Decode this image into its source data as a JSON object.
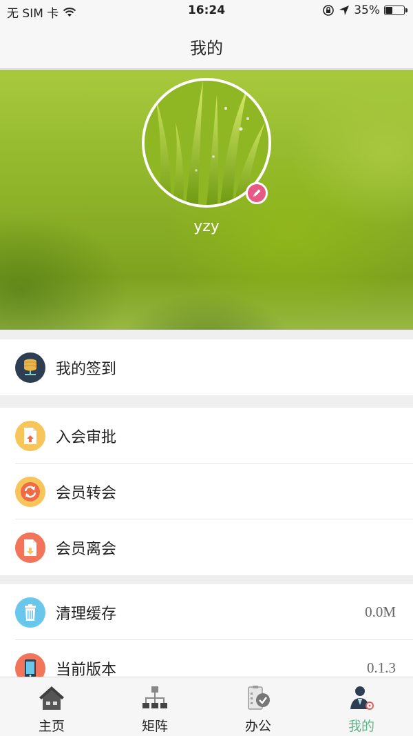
{
  "status_bar": {
    "carrier": "无 SIM 卡",
    "time": "16:24",
    "battery": "35%",
    "battery_level": 0.35
  },
  "nav": {
    "title": "我的"
  },
  "profile": {
    "username": "yzy"
  },
  "sections": {
    "checkin": {
      "label": "我的签到"
    },
    "join_approval": {
      "label": "入会审批"
    },
    "member_transfer": {
      "label": "会员转会"
    },
    "member_leave": {
      "label": "会员离会"
    },
    "clear_cache": {
      "label": "清理缓存",
      "value": "0.0M"
    },
    "version": {
      "label": "当前版本",
      "value": "0.1.3"
    }
  },
  "tabs": [
    {
      "label": "主页",
      "icon": "home-icon"
    },
    {
      "label": "矩阵",
      "icon": "matrix-icon"
    },
    {
      "label": "办公",
      "icon": "office-icon"
    },
    {
      "label": "我的",
      "icon": "profile-icon",
      "active": true
    }
  ],
  "colors": {
    "active_tab": "#5bb78a",
    "edit_badge": "#e85a86"
  }
}
